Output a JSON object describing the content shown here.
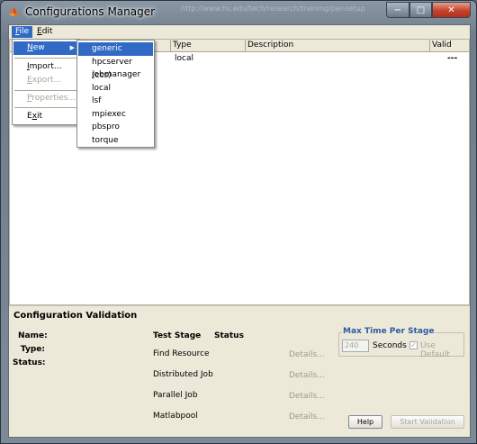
{
  "window": {
    "title": "Configurations Manager",
    "background_url_text": "http://www.hs.edu/tech/research/training/par-setup",
    "controls": {
      "minimize": "−",
      "maximize": "□",
      "close": "✕"
    }
  },
  "menubar": {
    "file": {
      "label": "File",
      "accel": "F",
      "rest": "ile"
    },
    "edit": {
      "label": "Edit",
      "accel": "E",
      "rest": "dit"
    }
  },
  "file_menu": {
    "new": {
      "label": "New",
      "accel": "N",
      "rest": "ew",
      "arrow": "▶"
    },
    "import": {
      "label": "Import...",
      "accel": "I",
      "rest": "mport..."
    },
    "export": {
      "label": "Export...",
      "accel": "E",
      "rest": "xport..."
    },
    "properties": {
      "label": "Properties...",
      "accel": "P",
      "rest": "roperties..."
    },
    "exit": {
      "label": "Exit",
      "accel": "x",
      "pre": "E",
      "rest": "it"
    }
  },
  "new_submenu": {
    "items": [
      "generic",
      "hpcserver (ccs)",
      "jobmanager",
      "local",
      "lsf",
      "mpiexec",
      "pbspro",
      "torque"
    ],
    "selected": "generic"
  },
  "table": {
    "columns": [
      "Type",
      "Description",
      "Valid"
    ],
    "rows": [
      {
        "type": "local",
        "description": "",
        "valid": "---"
      }
    ]
  },
  "validation": {
    "title": "Configuration Validation",
    "labels": {
      "name": "Name:",
      "type": "Type:",
      "status": "Status:"
    },
    "headers": {
      "test_stage": "Test Stage",
      "status": "Status"
    },
    "stages": [
      "Find Resource",
      "Distributed Job",
      "Parallel Job",
      "Matlabpool"
    ],
    "details_label": "Details...",
    "max_time": {
      "title": "Max Time Per Stage",
      "value": "240",
      "unit": "Seconds",
      "use_default_label": "Use Default",
      "use_default_checked": true
    },
    "help_label": "Help",
    "start_label": "Start Validation"
  },
  "colors": {
    "selection": "#316ac5",
    "panel": "#ece9d8",
    "group_title": "#2f5aa7",
    "disabled": "#a7a59c"
  }
}
